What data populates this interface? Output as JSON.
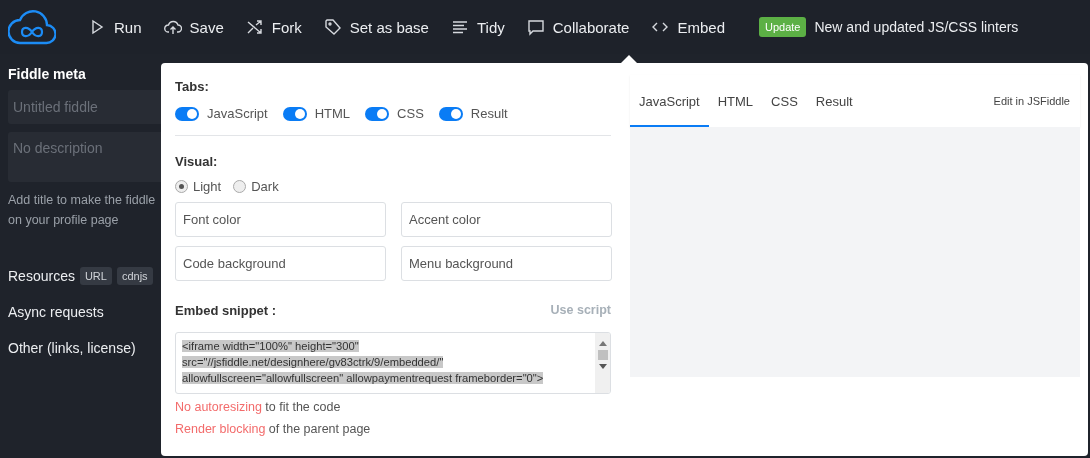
{
  "toolbar": {
    "items": [
      {
        "label": "Run"
      },
      {
        "label": "Save"
      },
      {
        "label": "Fork"
      },
      {
        "label": "Set as base"
      },
      {
        "label": "Tidy"
      },
      {
        "label": "Collaborate"
      },
      {
        "label": "Embed"
      }
    ],
    "update_badge": "Update",
    "update_text": "New and updated JS/CSS linters"
  },
  "sidebar": {
    "title": "Fiddle meta",
    "title_placeholder": "Untitled fiddle",
    "description_placeholder": "No description",
    "hint_lines": [
      "Add title to make the fiddle",
      "on your profile page"
    ],
    "sections": [
      {
        "label": "Resources",
        "tags": [
          "URL",
          "cdnjs"
        ]
      },
      {
        "label": "Async requests"
      },
      {
        "label": "Other (links, license)"
      }
    ]
  },
  "embed": {
    "tabs_heading": "Tabs:",
    "tabs": [
      {
        "label": "JavaScript",
        "checked": true
      },
      {
        "label": "HTML",
        "checked": true
      },
      {
        "label": "CSS",
        "checked": true
      },
      {
        "label": "Result",
        "checked": true
      }
    ],
    "visual_heading": "Visual:",
    "themes": [
      {
        "label": "Light",
        "selected": true
      },
      {
        "label": "Dark",
        "selected": false
      }
    ],
    "color_fields": [
      {
        "placeholder": "Font color"
      },
      {
        "placeholder": "Accent color"
      },
      {
        "placeholder": "Code background"
      },
      {
        "placeholder": "Menu background"
      }
    ],
    "snippet_heading": "Embed snippet :",
    "use_script": "Use script",
    "snippet_lines": [
      "<iframe width=\"100%\" height=\"300\"",
      "src=\"//jsfiddle.net/designhere/gv83ctrk/9/embedded/\"",
      "allowfullscreen=\"allowfullscreen\" allowpaymentrequest frameborder=\"0\">"
    ],
    "options": [
      {
        "link": "No autoresizing",
        "text": " to fit the code"
      },
      {
        "link": "Render blocking",
        "text": " of the parent page"
      }
    ]
  },
  "preview": {
    "tabs": [
      {
        "label": "JavaScript",
        "selected": true
      },
      {
        "label": "HTML",
        "selected": false
      },
      {
        "label": "CSS",
        "selected": false
      },
      {
        "label": "Result",
        "selected": false
      }
    ],
    "edit_link": "Edit in JSFiddle"
  }
}
